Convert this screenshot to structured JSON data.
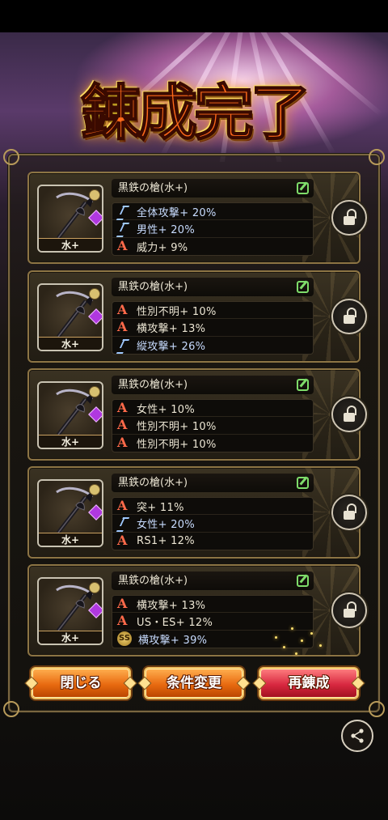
{
  "title": "錬成完了",
  "items": [
    {
      "name": "黒鉄の槍(水+)",
      "element": "水+",
      "stats": [
        {
          "grade": "S",
          "text": "全体攻撃+ 20%"
        },
        {
          "grade": "S",
          "text": "男性+ 20%"
        },
        {
          "grade": "A",
          "text": "威力+ 9%"
        }
      ]
    },
    {
      "name": "黒鉄の槍(水+)",
      "element": "水+",
      "stats": [
        {
          "grade": "A",
          "text": "性別不明+ 10%"
        },
        {
          "grade": "A",
          "text": "横攻撃+ 13%"
        },
        {
          "grade": "S",
          "text": "縦攻撃+ 26%"
        }
      ]
    },
    {
      "name": "黒鉄の槍(水+)",
      "element": "水+",
      "stats": [
        {
          "grade": "A",
          "text": "女性+ 10%"
        },
        {
          "grade": "A",
          "text": "性別不明+ 10%"
        },
        {
          "grade": "A",
          "text": "性別不明+ 10%"
        }
      ]
    },
    {
      "name": "黒鉄の槍(水+)",
      "element": "水+",
      "stats": [
        {
          "grade": "A",
          "text": "突+ 11%"
        },
        {
          "grade": "S",
          "text": "女性+ 20%"
        },
        {
          "grade": "A",
          "text": "RS1+ 12%"
        }
      ]
    },
    {
      "name": "黒鉄の槍(水+)",
      "element": "水+",
      "stats": [
        {
          "grade": "A",
          "text": "横攻撃+ 13%"
        },
        {
          "grade": "A",
          "text": "US・ES+ 12%"
        },
        {
          "grade": "SS",
          "text": "横攻撃+ 39%"
        }
      ]
    }
  ],
  "buttons": {
    "close": "閉じる",
    "change": "条件変更",
    "retry": "再錬成"
  },
  "colors": {
    "grade_S": "#9fc8ff",
    "grade_A": "#ff6a4a",
    "grade_SS": "#f0d070",
    "edit": "#7edc6a"
  },
  "icons": {
    "lock": "unlock-icon",
    "edit": "edit-icon",
    "share": "share-icon",
    "weapon": "spear-icon"
  }
}
